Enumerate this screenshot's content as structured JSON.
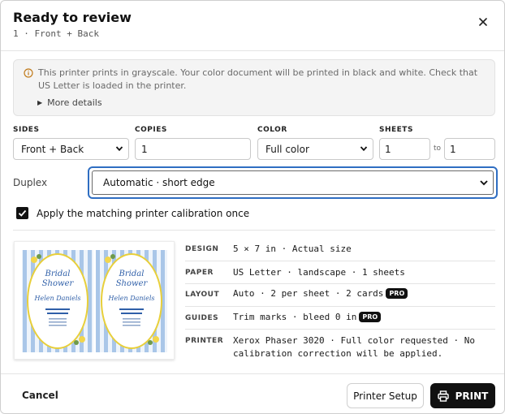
{
  "header": {
    "title": "Ready to review",
    "subtitle": "1 · Front + Back",
    "close_icon": "close-icon"
  },
  "notice": {
    "text": "This printer prints in grayscale. Your color document will be printed in black and white. Check that US Letter is loaded in the printer.",
    "more_details": "More details",
    "icon": "info-icon"
  },
  "options": {
    "sides": {
      "label": "SIDES",
      "value": "Front + Back"
    },
    "copies": {
      "label": "COPIES",
      "value": "1"
    },
    "color": {
      "label": "COLOR",
      "value": "Full color"
    },
    "sheets": {
      "label": "SHEETS",
      "from": "1",
      "to_label": "to",
      "to": "1"
    }
  },
  "duplex": {
    "label": "Duplex",
    "value": "Automatic · short edge"
  },
  "calibration": {
    "checked": true,
    "label": "Apply the matching printer calibration once"
  },
  "preview": {
    "cards": [
      {
        "line1": "Bridal",
        "line2": "Shower",
        "name": "Helen Daniels"
      },
      {
        "line1": "Bridal",
        "line2": "Shower",
        "name": "Helen Daniels"
      }
    ],
    "colors": {
      "stripe": "#a9c6e8",
      "frame": "#e8cf3a",
      "script": "#2f5fa8"
    }
  },
  "specs": [
    {
      "key": "DESIGN",
      "value": "5 × 7 in · Actual size",
      "pro": false
    },
    {
      "key": "PAPER",
      "value": "US Letter · landscape · 1 sheets",
      "pro": false
    },
    {
      "key": "LAYOUT",
      "value": "Auto · 2 per sheet · 2 cards",
      "pro": true
    },
    {
      "key": "GUIDES",
      "value": "Trim marks · bleed 0 in",
      "pro": true
    },
    {
      "key": "PRINTER",
      "value": "Xerox Phaser 3020 · Full color requested · No calibration correction will be applied.",
      "pro": false
    }
  ],
  "pro_badge": "PRO",
  "footer": {
    "cancel": "Cancel",
    "printer_setup": "Printer Setup",
    "print": "PRINT",
    "print_icon": "printer-icon"
  }
}
